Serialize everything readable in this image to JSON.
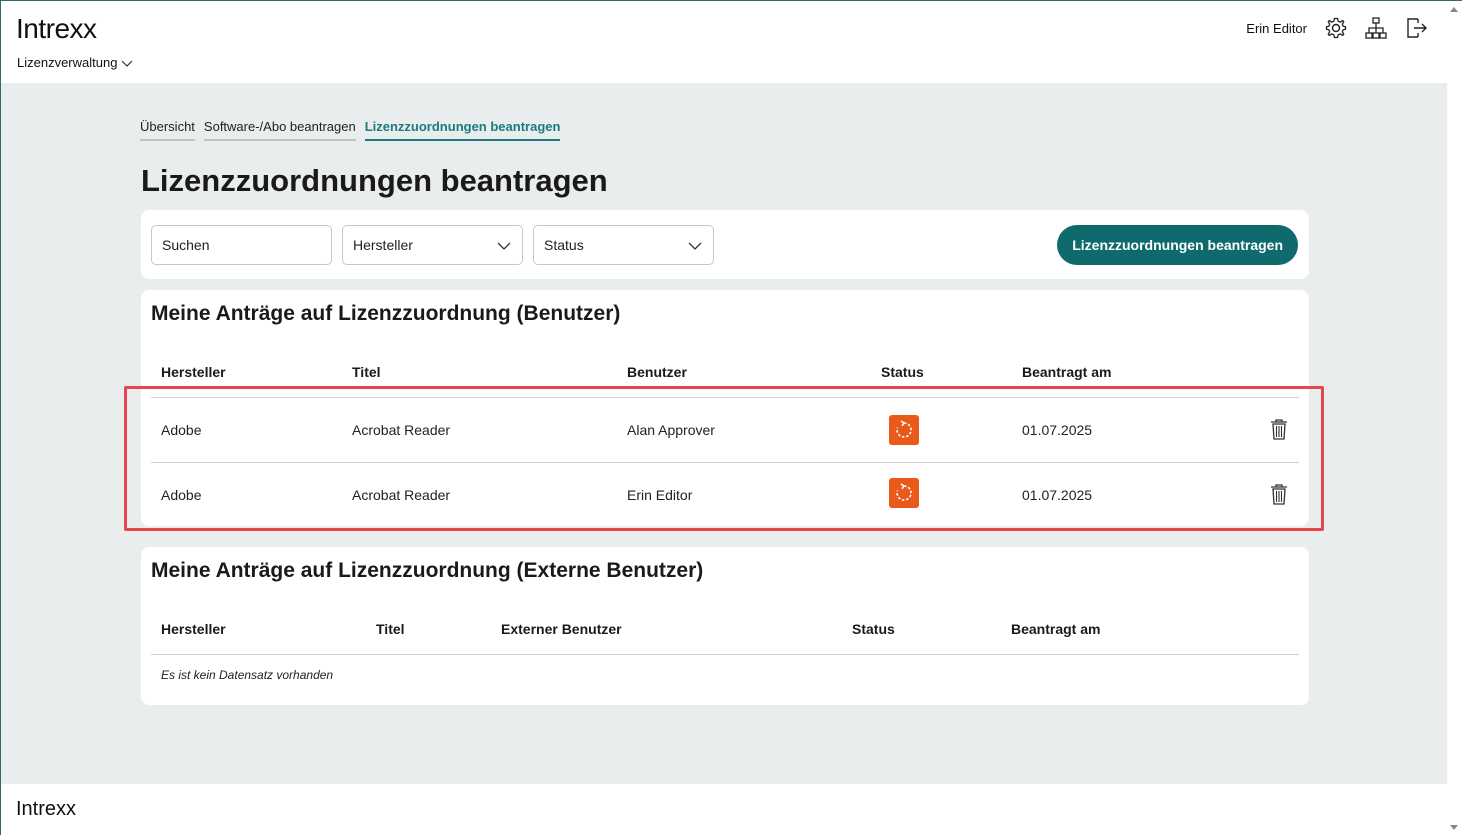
{
  "header": {
    "logo": "Intrexx",
    "app_nav_label": "Lizenzverwaltung",
    "username": "Erin Editor",
    "icons": [
      "gear-icon",
      "sitemap-icon",
      "logout-icon"
    ]
  },
  "tabs": [
    {
      "label": "Übersicht",
      "active": false
    },
    {
      "label": "Software-/Abo beantragen",
      "active": false
    },
    {
      "label": "Lizenzzuordnungen beantragen",
      "active": true
    }
  ],
  "page_title": "Lizenzzuordnungen beantragen",
  "filters": {
    "search_value": "Suchen",
    "manufacturer_label": "Hersteller",
    "status_label": "Status",
    "primary_button": "Lizenzzuordnungen beantragen"
  },
  "users_section": {
    "title": "Meine Anträge auf Lizenzzuordnung (Benutzer)",
    "columns": [
      "Hersteller",
      "Titel",
      "Benutzer",
      "Status",
      "Beantragt am"
    ],
    "rows": [
      {
        "manufacturer": "Adobe",
        "title": "Acrobat Reader",
        "user": "Alan Approver",
        "status_icon": "refresh-icon",
        "requested_on": "01.07.2025"
      },
      {
        "manufacturer": "Adobe",
        "title": "Acrobat Reader",
        "user": "Erin Editor",
        "status_icon": "refresh-icon",
        "requested_on": "01.07.2025"
      }
    ]
  },
  "external_section": {
    "title": "Meine Anträge auf Lizenzzuordnung (Externe Benutzer)",
    "columns": [
      "Hersteller",
      "Titel",
      "Externer Benutzer",
      "Status",
      "Beantragt am"
    ],
    "empty_text": "Es ist kein Datensatz vorhanden"
  },
  "footer": {
    "logo": "Intrexx"
  },
  "colors": {
    "accent": "#0f6a6e",
    "status": "#e8591a",
    "highlight": "#e8454f"
  }
}
